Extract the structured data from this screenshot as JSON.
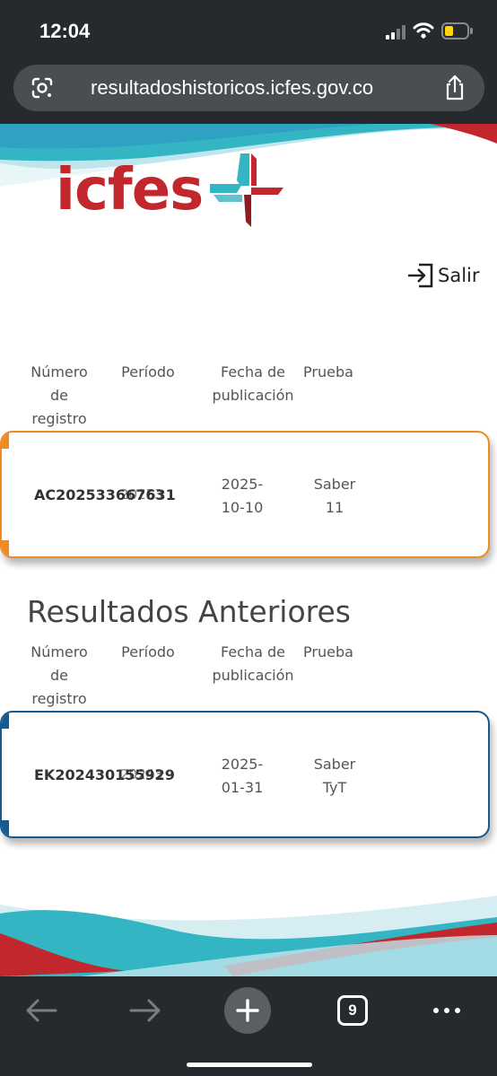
{
  "status_bar": {
    "time": "12:04"
  },
  "browser": {
    "url": "resultadoshistoricos.icfes.gov.co",
    "tab_count": "9"
  },
  "header": {
    "logo_text": "icfes",
    "logout_label": "Salir",
    "colors": {
      "brand_red": "#c1272d",
      "brand_teal": "#33b5c4"
    }
  },
  "current": {
    "columns": [
      "Número de registro",
      "Período",
      "Fecha de publicación",
      "Prueba"
    ],
    "row": {
      "registro": "AC202533667631",
      "periodo": "20253",
      "fecha": "2025-10-10",
      "prueba": "Saber 11",
      "accent_color": "#f08a24"
    }
  },
  "previous": {
    "title": "Resultados Anteriores",
    "columns": [
      "Número de registro",
      "Período",
      "Fecha de publicación",
      "Prueba"
    ],
    "row": {
      "registro": "EK202430155929",
      "periodo": "20243",
      "fecha": "2025-01-31",
      "prueba": "Saber TyT",
      "accent_color": "#155b92"
    }
  },
  "toolbar": {
    "icons": [
      "back-arrow-icon",
      "forward-arrow-icon",
      "new-tab-icon",
      "tabs-icon",
      "more-icon"
    ]
  }
}
